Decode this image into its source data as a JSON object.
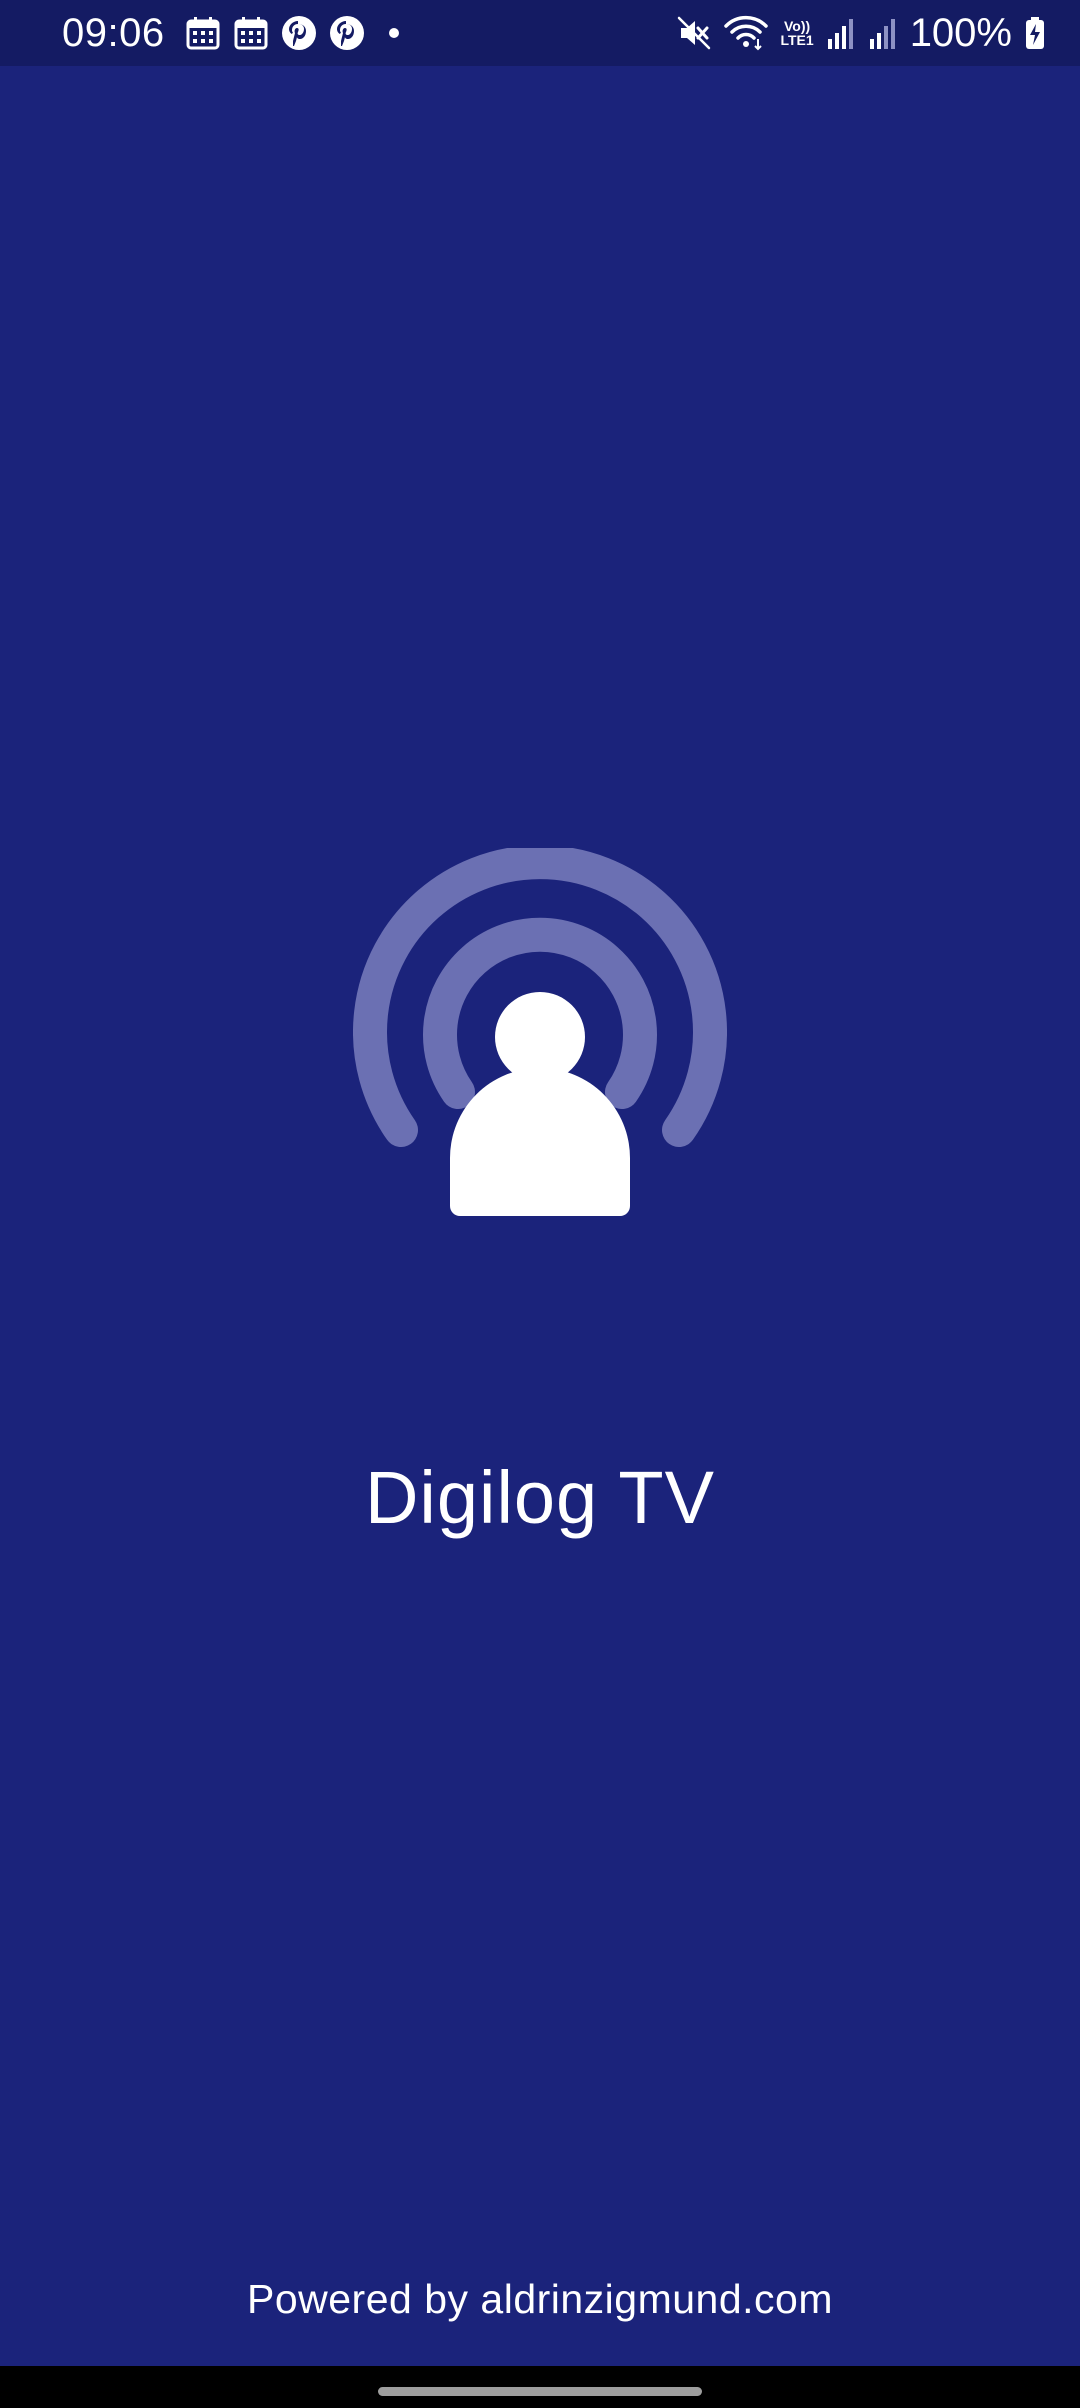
{
  "status_bar": {
    "time": "09:06",
    "notification_icons": [
      "calendar-icon",
      "calendar-icon",
      "pinterest-icon",
      "pinterest-icon",
      "more-dot-icon"
    ],
    "system_icons": [
      "mute-icon",
      "wifi-icon",
      "volte-icon",
      "signal-icon",
      "signal-icon",
      "battery-charging-icon"
    ],
    "volte_text": "Vo))",
    "lte_text": "LTE1",
    "battery_percent": "100%"
  },
  "splash": {
    "logo_icon": "podcast-broadcast-icon",
    "app_name": "Digilog TV",
    "powered_by": "Powered by aldrinzigmund.com"
  },
  "colors": {
    "background": "#1b237b",
    "status_bar": "#141b63",
    "logo_rings": "#6b70b3",
    "text": "#ffffff"
  }
}
